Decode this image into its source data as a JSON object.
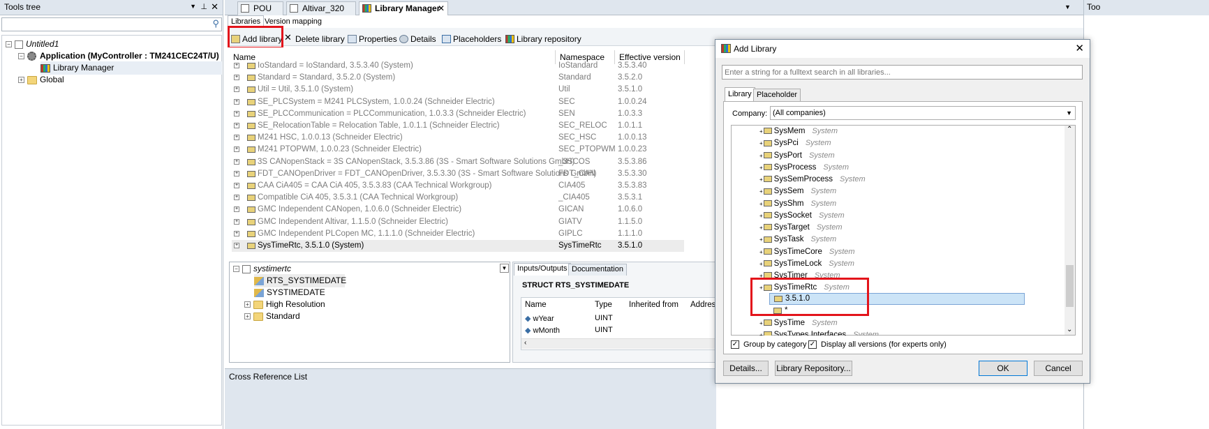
{
  "tools_tree": {
    "title": "Tools tree",
    "items": [
      {
        "label": "Untitled1"
      },
      {
        "label": "Application (MyController : TM241CEC24T/U)"
      },
      {
        "label": "Library Manager"
      },
      {
        "label": "Global"
      }
    ]
  },
  "tabs": [
    {
      "label": "POU"
    },
    {
      "label": "Altivar_320"
    },
    {
      "label": "Library Manager"
    }
  ],
  "subtabs": [
    {
      "label": "Libraries"
    },
    {
      "label": "Version mapping"
    }
  ],
  "toolbar": {
    "add_library": "Add library",
    "delete_library": "Delete library",
    "properties": "Properties",
    "details": "Details",
    "placeholders": "Placeholders",
    "library_repository": "Library repository"
  },
  "library_table": {
    "columns": [
      "Name",
      "Namespace",
      "Effective version"
    ],
    "rows": [
      {
        "name": "IoStandard = IoStandard, 3.5.3.40 (System)",
        "ns": "IoStandard",
        "ver": "3.5.3.40"
      },
      {
        "name": "Standard = Standard, 3.5.2.0 (System)",
        "ns": "Standard",
        "ver": "3.5.2.0"
      },
      {
        "name": "Util = Util, 3.5.1.0 (System)",
        "ns": "Util",
        "ver": "3.5.1.0"
      },
      {
        "name": "SE_PLCSystem = M241 PLCSystem, 1.0.0.24 (Schneider Electric)",
        "ns": "SEC",
        "ver": "1.0.0.24"
      },
      {
        "name": "SE_PLCCommunication = PLCCommunication, 1.0.3.3 (Schneider Electric)",
        "ns": "SEN",
        "ver": "1.0.3.3"
      },
      {
        "name": "SE_RelocationTable = Relocation Table, 1.0.1.1 (Schneider Electric)",
        "ns": "SEC_RELOC",
        "ver": "1.0.1.1"
      },
      {
        "name": "M241 HSC, 1.0.0.13 (Schneider Electric)",
        "ns": "SEC_HSC",
        "ver": "1.0.0.13"
      },
      {
        "name": "M241 PTOPWM, 1.0.0.23 (Schneider Electric)",
        "ns": "SEC_PTOPWM",
        "ver": "1.0.0.23"
      },
      {
        "name": "3S CANopenStack = 3S CANopenStack, 3.5.3.86 (3S - Smart Software Solutions GmbH)",
        "ns": "_3SCOS",
        "ver": "3.5.3.86"
      },
      {
        "name": "FDT_CANOpenDriver = FDT_CANOpenDriver, 3.5.3.30 (3S - Smart Software Solutions GmbH)",
        "ns": "FDT_CAN",
        "ver": "3.5.3.30"
      },
      {
        "name": "CAA CiA405 = CAA CiA 405, 3.5.3.83 (CAA Technical Workgroup)",
        "ns": "CIA405",
        "ver": "3.5.3.83"
      },
      {
        "name": "Compatible CiA 405, 3.5.3.1 (CAA Technical Workgroup)",
        "ns": "_CIA405",
        "ver": "3.5.3.1"
      },
      {
        "name": "GMC Independent CANopen, 1.0.6.0 (Schneider Electric)",
        "ns": "GICAN",
        "ver": "1.0.6.0"
      },
      {
        "name": "GMC Independent Altivar, 1.1.5.0 (Schneider Electric)",
        "ns": "GIATV",
        "ver": "1.1.5.0"
      },
      {
        "name": "GMC Independent PLCopen MC, 1.1.1.0 (Schneider Electric)",
        "ns": "GIPLC",
        "ver": "1.1.1.0"
      },
      {
        "name": "SysTimeRtc, 3.5.1.0 (System)",
        "ns": "SysTimeRtc",
        "ver": "3.5.1.0"
      }
    ]
  },
  "lib_tree": {
    "root": "systimertc",
    "items": [
      "RTS_SYSTIMEDATE",
      "SYSTIMEDATE",
      "High Resolution",
      "Standard"
    ]
  },
  "detail_tabs": [
    {
      "label": "Inputs/Outputs"
    },
    {
      "label": "Documentation"
    }
  ],
  "struct_title": "STRUCT  RTS_SYSTIMEDATE",
  "io_table": {
    "columns": [
      "Name",
      "Type",
      "Inherited from",
      "Address"
    ],
    "rows": [
      {
        "name": "wYear",
        "type": "UINT"
      },
      {
        "name": "wMonth",
        "type": "UINT"
      }
    ]
  },
  "cross_ref": {
    "title": "Cross Reference List"
  },
  "right_pane": {
    "title": "Too"
  },
  "dialog": {
    "title": "Add Library",
    "search_placeholder": "Enter a string for a fulltext search in all libraries...",
    "tabs": [
      {
        "label": "Library"
      },
      {
        "label": "Placeholder"
      }
    ],
    "company_label": "Company:",
    "company_value": "(All companies)",
    "list": [
      {
        "name": "SysMem",
        "cat": "System"
      },
      {
        "name": "SysPci",
        "cat": "System"
      },
      {
        "name": "SysPort",
        "cat": "System"
      },
      {
        "name": "SysProcess",
        "cat": "System"
      },
      {
        "name": "SysSemProcess",
        "cat": "System"
      },
      {
        "name": "SysSem",
        "cat": "System"
      },
      {
        "name": "SysShm",
        "cat": "System"
      },
      {
        "name": "SysSocket",
        "cat": "System"
      },
      {
        "name": "SysTarget",
        "cat": "System"
      },
      {
        "name": "SysTask",
        "cat": "System"
      },
      {
        "name": "SysTimeCore",
        "cat": "System"
      },
      {
        "name": "SysTimeLock",
        "cat": "System"
      },
      {
        "name": "SysTimer",
        "cat": "System"
      },
      {
        "name": "SysTimeRtc",
        "cat": "System"
      }
    ],
    "selected_version": "3.5.1.0",
    "star_version": "*",
    "after_list": [
      {
        "name": "SysTime",
        "cat": "System"
      },
      {
        "name": "SysTypes Interfaces",
        "cat": "System"
      }
    ],
    "group_by_category": "Group by category",
    "display_all_versions": "Display all versions (for experts only)",
    "details_btn": "Details...",
    "repo_btn": "Library Repository...",
    "ok_btn": "OK",
    "cancel_btn": "Cancel"
  },
  "colors": {
    "highlight_red": "#e3141b",
    "selection": "#cce4f7",
    "chrome": "#dfe6ee"
  }
}
